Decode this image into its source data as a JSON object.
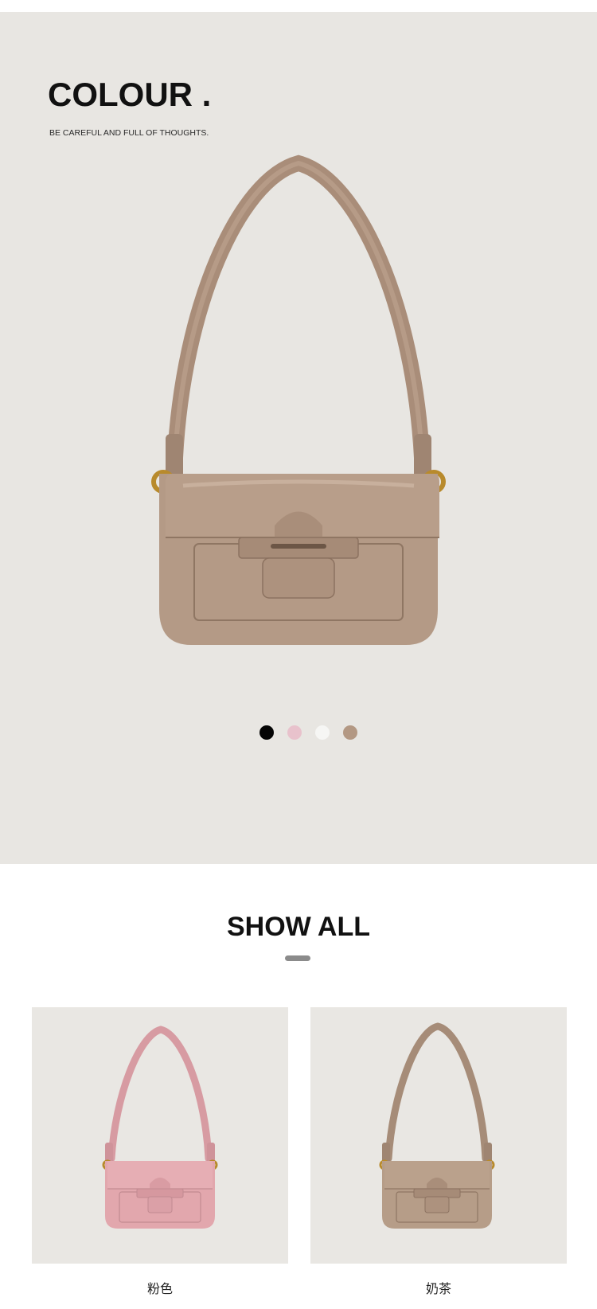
{
  "hero": {
    "title": "COLOUR .",
    "subtitle": "BE CAREFUL AND FULL OF THOUGHTS.",
    "bag_color": "#b49a86",
    "swatches": [
      {
        "name": "black",
        "color": "#050505"
      },
      {
        "name": "pink",
        "color": "#e8c2cc"
      },
      {
        "name": "white",
        "color": "#f6f6f4"
      },
      {
        "name": "khaki",
        "color": "#b39883"
      }
    ]
  },
  "show_all": {
    "title": "SHOW ALL",
    "items": [
      {
        "label": "粉色",
        "color": "#e2a7ad"
      },
      {
        "label": "奶茶",
        "color": "#b69d88"
      }
    ]
  }
}
